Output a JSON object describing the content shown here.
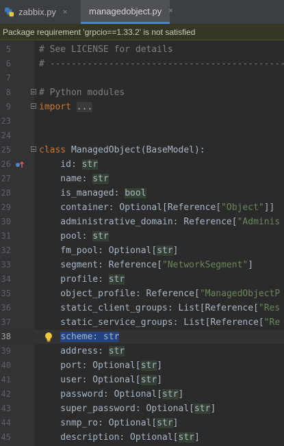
{
  "tabs": [
    {
      "label": "zabbix.py",
      "active": false
    },
    {
      "label": "managedobject.py",
      "active": true
    }
  ],
  "close_glyph": "×",
  "banner": {
    "text": "Package requirement 'grpcio==1.33.2' is not satisfied"
  },
  "colors": {
    "keyword": "#cc7832",
    "string": "#6a8759",
    "comment": "#808080",
    "text": "#a9b7c6",
    "type_highlight": "#344134",
    "selection": "#214283",
    "tab_underline": "#4a88c7"
  },
  "lines": [
    {
      "n": "5",
      "tokens": [
        [
          "cm",
          "# See LICENSE for details"
        ]
      ]
    },
    {
      "n": "6",
      "tokens": [
        [
          "cm",
          "# -------------------------------------------------"
        ]
      ]
    },
    {
      "n": "7",
      "tokens": []
    },
    {
      "n": "8",
      "tokens": [
        [
          "cm",
          "# Python modules"
        ]
      ],
      "fold": true
    },
    {
      "n": "9",
      "tokens": [
        [
          "kw",
          "import"
        ],
        [
          "txt",
          " "
        ],
        [
          "fr",
          "..."
        ]
      ],
      "fold": true
    },
    {
      "n": "23",
      "tokens": []
    },
    {
      "n": "24",
      "tokens": []
    },
    {
      "n": "25",
      "tokens": [
        [
          "kw",
          "class"
        ],
        [
          "txt",
          " ManagedObject(BaseModel):"
        ]
      ],
      "fold": true
    },
    {
      "n": "26",
      "tokens": [
        [
          "txt",
          "    id: "
        ],
        [
          "ty",
          "str"
        ]
      ],
      "mark": true
    },
    {
      "n": "27",
      "tokens": [
        [
          "txt",
          "    name: "
        ],
        [
          "ty",
          "str"
        ]
      ]
    },
    {
      "n": "28",
      "tokens": [
        [
          "txt",
          "    is_managed: "
        ],
        [
          "ty",
          "bool"
        ]
      ]
    },
    {
      "n": "29",
      "tokens": [
        [
          "txt",
          "    container: Optional[Reference["
        ],
        [
          "st",
          "\"Object\""
        ],
        [
          "txt",
          "]]"
        ]
      ]
    },
    {
      "n": "30",
      "tokens": [
        [
          "txt",
          "    administrative_domain: Reference["
        ],
        [
          "st",
          "\"Adminis"
        ]
      ]
    },
    {
      "n": "31",
      "tokens": [
        [
          "txt",
          "    pool: "
        ],
        [
          "ty",
          "str"
        ]
      ]
    },
    {
      "n": "32",
      "tokens": [
        [
          "txt",
          "    fm_pool: Optional["
        ],
        [
          "ty",
          "str"
        ],
        [
          "txt",
          "]"
        ]
      ]
    },
    {
      "n": "33",
      "tokens": [
        [
          "txt",
          "    segment: Reference["
        ],
        [
          "st",
          "\"NetworkSegment\""
        ],
        [
          "txt",
          "]"
        ]
      ]
    },
    {
      "n": "34",
      "tokens": [
        [
          "txt",
          "    profile: "
        ],
        [
          "ty",
          "str"
        ]
      ]
    },
    {
      "n": "35",
      "tokens": [
        [
          "txt",
          "    object_profile: Reference["
        ],
        [
          "st",
          "\"ManagedObjectP"
        ]
      ]
    },
    {
      "n": "36",
      "tokens": [
        [
          "txt",
          "    static_client_groups: List[Reference["
        ],
        [
          "st",
          "\"Res"
        ]
      ]
    },
    {
      "n": "37",
      "tokens": [
        [
          "txt",
          "    static_service_groups: List[Reference["
        ],
        [
          "st",
          "\"Re"
        ]
      ]
    },
    {
      "n": "38",
      "tokens": [
        [
          "txt",
          "    "
        ],
        [
          "sel",
          "scheme: str"
        ]
      ],
      "current": true,
      "bulb": true
    },
    {
      "n": "39",
      "tokens": [
        [
          "txt",
          "    address: "
        ],
        [
          "ty",
          "str"
        ]
      ]
    },
    {
      "n": "40",
      "tokens": [
        [
          "txt",
          "    port: Optional["
        ],
        [
          "ty",
          "str"
        ],
        [
          "txt",
          "]"
        ]
      ]
    },
    {
      "n": "41",
      "tokens": [
        [
          "txt",
          "    user: Optional["
        ],
        [
          "ty",
          "str"
        ],
        [
          "txt",
          "]"
        ]
      ]
    },
    {
      "n": "42",
      "tokens": [
        [
          "txt",
          "    password: Optional["
        ],
        [
          "ty",
          "str"
        ],
        [
          "txt",
          "]"
        ]
      ]
    },
    {
      "n": "43",
      "tokens": [
        [
          "txt",
          "    super_password: Optional["
        ],
        [
          "ty",
          "str"
        ],
        [
          "txt",
          "]"
        ]
      ]
    },
    {
      "n": "44",
      "tokens": [
        [
          "txt",
          "    snmp_ro: Optional["
        ],
        [
          "ty",
          "str"
        ],
        [
          "txt",
          "]"
        ]
      ]
    },
    {
      "n": "45",
      "tokens": [
        [
          "txt",
          "    description: Optional["
        ],
        [
          "ty",
          "str"
        ],
        [
          "txt",
          "]"
        ]
      ]
    }
  ]
}
